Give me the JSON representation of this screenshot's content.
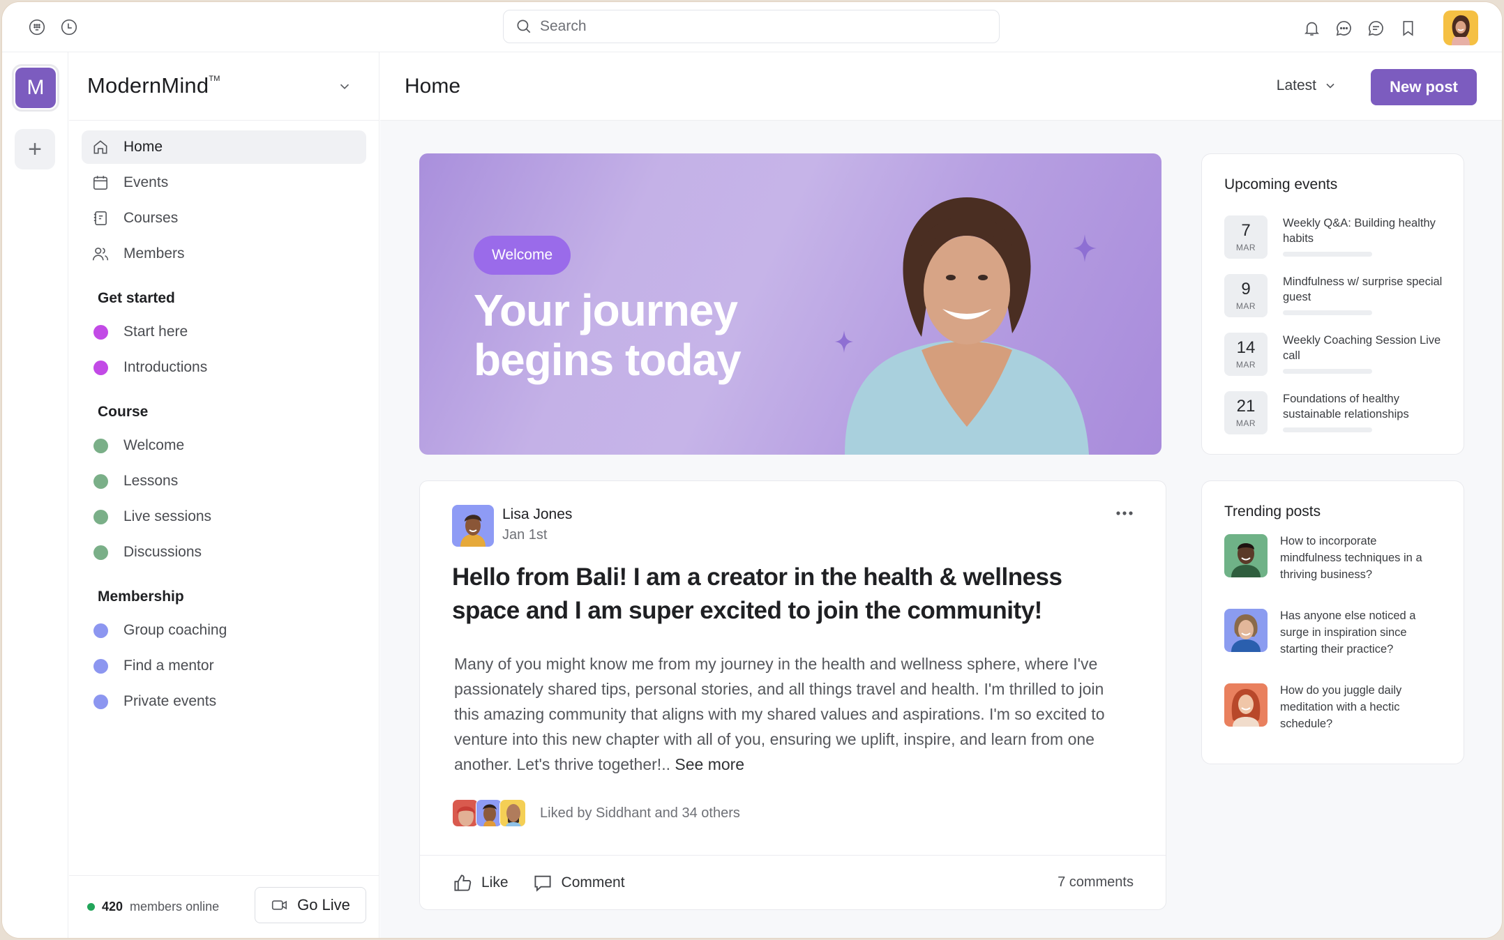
{
  "topbar": {
    "left_icons": [
      "apps-grid-icon",
      "history-clock-icon"
    ],
    "search": {
      "placeholder": "Search",
      "value": ""
    },
    "right_icons": [
      "bell-icon",
      "chat-bubble-icon",
      "messages-icon",
      "bookmark-icon"
    ],
    "user_avatar": "user-avatar"
  },
  "rail": {
    "community_initial": "M",
    "add_label": "+"
  },
  "nav": {
    "brand": "ModernMind",
    "brand_mark": "TM",
    "main_items": [
      {
        "label": "Home",
        "icon": "home-icon",
        "active": true
      },
      {
        "label": "Events",
        "icon": "calendar-icon",
        "active": false
      },
      {
        "label": "Courses",
        "icon": "notebook-icon",
        "active": false
      },
      {
        "label": "Members",
        "icon": "members-icon",
        "active": false
      }
    ],
    "sections": [
      {
        "title": "Get started",
        "color": "#c24ae6",
        "items": [
          "Start here",
          "Introductions"
        ]
      },
      {
        "title": "Course",
        "color": "#7aaf88",
        "items": [
          "Welcome",
          "Lessons",
          "Live sessions",
          "Discussions"
        ]
      },
      {
        "title": "Membership",
        "color": "#8c96f0",
        "items": [
          "Group coaching",
          "Find a mentor",
          "Private events"
        ]
      }
    ],
    "footer": {
      "online_count": "420",
      "online_label": "members online",
      "online_color": "#22a55a",
      "go_live_label": "Go Live"
    }
  },
  "main": {
    "title": "Home",
    "sort_label": "Latest",
    "new_post_label": "New post",
    "accent": "#7c5cbf"
  },
  "hero": {
    "badge": "Welcome",
    "title_line1": "Your journey",
    "title_line2": "begins today"
  },
  "post": {
    "author": "Lisa Jones",
    "date": "Jan 1st",
    "title": "Hello from Bali! I am a creator in the health & wellness space and I am super excited to join the community!",
    "body": "Many of you might know me from my journey in the health and wellness sphere, where I've passionately shared tips, personal stories, and all things travel and health. I'm thrilled to join this amazing community that aligns with my shared values and aspirations. I'm so excited to venture into this new chapter with all of you, ensuring we uplift, inspire, and learn from one another. Let's thrive together!..",
    "see_more": "See more",
    "likes_text": "Liked by Siddhant and 34 others",
    "like_label": "Like",
    "comment_label": "Comment",
    "comments_count": "7 comments"
  },
  "upcoming_events": {
    "title": "Upcoming events",
    "items": [
      {
        "day": "7",
        "month": "MAR",
        "title": "Weekly Q&A: Building healthy habits"
      },
      {
        "day": "9",
        "month": "MAR",
        "title": "Mindfulness w/ surprise special guest"
      },
      {
        "day": "14",
        "month": "MAR",
        "title": "Weekly Coaching Session Live call"
      },
      {
        "day": "21",
        "month": "MAR",
        "title": "Foundations of healthy sustainable relationships"
      }
    ]
  },
  "trending_posts": {
    "title": "Trending posts",
    "items": [
      {
        "title": "How to incorporate mindfulness techniques in a thriving business?",
        "avatar_bg": "#6fb287"
      },
      {
        "title": "Has anyone else noticed a surge in inspiration since starting their practice?",
        "avatar_bg": "#8b9cf0"
      },
      {
        "title": "How do you juggle daily meditation with a hectic schedule?",
        "avatar_bg": "#e9805e"
      }
    ]
  }
}
